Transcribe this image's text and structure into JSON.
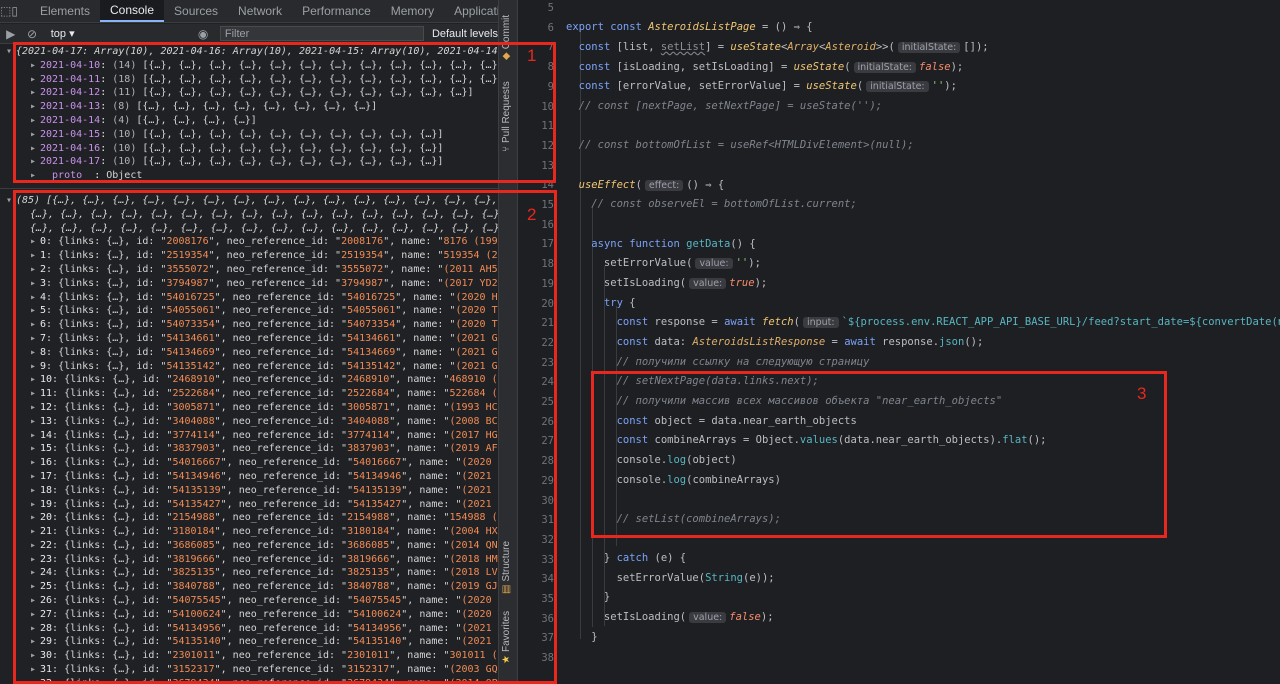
{
  "devtools": {
    "tabs": [
      "Elements",
      "Console",
      "Sources",
      "Network",
      "Performance",
      "Memory",
      "Application"
    ],
    "active_tab": "Console",
    "context_value": "top",
    "filter_placeholder": "Filter",
    "level_label": "Default levels",
    "object_summary": "{2021-04-17: Array(10), 2021-04-16: Array(10), 2021-04-15: Array(10), 2021-04-14: Array(4)...",
    "object_entries": [
      {
        "key": "2021-04-10",
        "count": "(14)",
        "items": "[{…}, {…}, {…}, {…}, {…}, {…}, {…}, {…}, {…}, {…}, {…}, {…}, {…}, {…}]"
      },
      {
        "key": "2021-04-11",
        "count": "(18)",
        "items": "[{…}, {…}, {…}, {…}, {…}, {…}, {…}, {…}, {…}, {…}, {…}, {…}, {…}, {…}, {…}, {…}]"
      },
      {
        "key": "2021-04-12",
        "count": "(11)",
        "items": "[{…}, {…}, {…}, {…}, {…}, {…}, {…}, {…}, {…}, {…}, {…}]"
      },
      {
        "key": "2021-04-13",
        "count": "(8)",
        "items": "[{…}, {…}, {…}, {…}, {…}, {…}, {…}, {…}]"
      },
      {
        "key": "2021-04-14",
        "count": "(4)",
        "items": "[{…}, {…}, {…}, {…}]"
      },
      {
        "key": "2021-04-15",
        "count": "(10)",
        "items": "[{…}, {…}, {…}, {…}, {…}, {…}, {…}, {…}, {…}, {…}]"
      },
      {
        "key": "2021-04-16",
        "count": "(10)",
        "items": "[{…}, {…}, {…}, {…}, {…}, {…}, {…}, {…}, {…}, {…}]"
      },
      {
        "key": "2021-04-17",
        "count": "(10)",
        "items": "[{…}, {…}, {…}, {…}, {…}, {…}, {…}, {…}, {…}, {…}]"
      }
    ],
    "proto_key": "__proto__",
    "proto_value": "Object",
    "array_summary_lines": [
      "(85) [{…}, {…}, {…}, {…}, {…}, {…}, {…}, {…}, {…}, {…}, {…}, {…}, {…}, {…}, {…}, {…}, {…}, {…}, {…}, {…},",
      "{…}, {…}, {…}, {…}, {…}, {…}, {…}, {…}, {…}, {…}, {…}, {…}, {…}, {…}, {…}, {…}, {…}, {…}, {…}, {…}, {…},",
      "{…}, {…}, {…}, {…}, {…}, {…}, {…}, {…}, {…}, {…}, {…}, {…}, {…}, {…}, {…}, {…}, {…}, {…}, {…}, {…}, {…},"
    ],
    "array_rows": [
      {
        "i": "0",
        "id": "2008176",
        "name": "8176 (1991 WA)"
      },
      {
        "i": "1",
        "id": "2519354",
        "name": "519354 (2011 K"
      },
      {
        "i": "2",
        "id": "3555072",
        "name": "(2011 AH5)"
      },
      {
        "i": "3",
        "id": "3794987",
        "name": "(2017 YD2)"
      },
      {
        "i": "4",
        "id": "54016725",
        "name": "(2020 HE5)"
      },
      {
        "i": "5",
        "id": "54055061",
        "name": "(2020 TR1)"
      },
      {
        "i": "6",
        "id": "54073354",
        "name": "(2020 TR7)"
      },
      {
        "i": "7",
        "id": "54134661",
        "name": "(2021 GH1)"
      },
      {
        "i": "8",
        "id": "54134669",
        "name": "(2021 GQ1)"
      },
      {
        "i": "9",
        "id": "54135142",
        "name": "(2021 GC3)"
      },
      {
        "i": "10",
        "id": "2468910",
        "name": "468910 (2014"
      },
      {
        "i": "11",
        "id": "2522684",
        "name": "522684 (2016"
      },
      {
        "i": "12",
        "id": "3005871",
        "name": "(1993 HC)"
      },
      {
        "i": "13",
        "id": "3404088",
        "name": "(2008 BC22)"
      },
      {
        "i": "14",
        "id": "3774114",
        "name": "(2017 HG4)"
      },
      {
        "i": "15",
        "id": "3837903",
        "name": "(2019 AF13)"
      },
      {
        "i": "16",
        "id": "54016667",
        "name": "(2020 HM3)"
      },
      {
        "i": "17",
        "id": "54134946",
        "name": "(2021 GG2)"
      },
      {
        "i": "18",
        "id": "54135139",
        "name": "(2021 GW2)"
      },
      {
        "i": "19",
        "id": "54135427",
        "name": "(2021 GP3)"
      },
      {
        "i": "20",
        "id": "2154988",
        "name": "154988 (2004"
      },
      {
        "i": "21",
        "id": "3180184",
        "name": "(2004 HX53)"
      },
      {
        "i": "22",
        "id": "3686085",
        "name": "(2014 QN433)"
      },
      {
        "i": "23",
        "id": "3819666",
        "name": "(2018 HM2)"
      },
      {
        "i": "24",
        "id": "3825135",
        "name": "(2018 LV2)"
      },
      {
        "i": "25",
        "id": "3840788",
        "name": "(2019 GJ1)"
      },
      {
        "i": "26",
        "id": "54075545",
        "name": "(2020 UY1)"
      },
      {
        "i": "27",
        "id": "54100624",
        "name": "(2020 YH)"
      },
      {
        "i": "28",
        "id": "54134956",
        "name": "(2021 GQ2)"
      },
      {
        "i": "29",
        "id": "54135140",
        "name": "(2021 GX2)"
      },
      {
        "i": "30",
        "id": "2301011",
        "name": "301011 (2008"
      },
      {
        "i": "31",
        "id": "3152317",
        "name": "(2003 GQ22)"
      },
      {
        "i": "32",
        "id": "3679434",
        "name": "(2014 OP344)"
      }
    ]
  },
  "strip": {
    "commit": "Commit",
    "pull_requests": "Pull Requests",
    "structure": "Structure",
    "favorites": "Favorites"
  },
  "editor": {
    "line_numbers": [
      "5",
      "6",
      "7",
      "8",
      "9",
      "10",
      "11",
      "12",
      "13",
      "14",
      "15",
      "16",
      "17",
      "18",
      "19",
      "20",
      "21",
      "22",
      "23",
      "24",
      "25",
      "26",
      "27",
      "28",
      "29",
      "30",
      "31",
      "32",
      "33",
      "34",
      "35",
      "36",
      "37",
      "38"
    ],
    "hints": {
      "initial_state": "initialState:",
      "effect": "effect:",
      "value": "value:",
      "input": "input:"
    },
    "comments": {
      "next_page": "// const [nextPage, setNextPage] = useState('');",
      "bottom": "// const bottomOfList = useRef<HTMLDivElement>(null);",
      "observe": "// const observeEl = bottomOfList.current;",
      "link_next": "// получили ссылку на следующую страницу",
      "set_next_page": "// setNextPage(data.links.next);",
      "all_arrays": "// получили массив всех массивов объекта \"near_earth_objects\"",
      "set_list": "// setList(combineArrays);"
    },
    "fetch_template": "`${process.env.REACT_APP_API_BASE_URL}/feed?start_date=${convertDate(new Dat"
  },
  "annotations": [
    "1",
    "2",
    "3"
  ]
}
